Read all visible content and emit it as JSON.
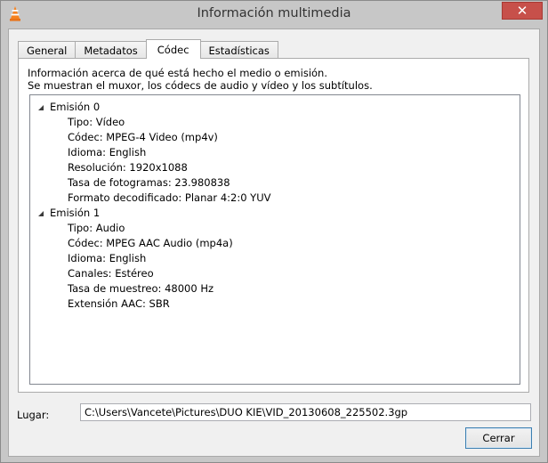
{
  "window": {
    "title": "Información multimedia",
    "close_glyph": "✕"
  },
  "tabs": [
    {
      "label": "General",
      "active": false
    },
    {
      "label": "Metadatos",
      "active": false
    },
    {
      "label": "Códec",
      "active": true
    },
    {
      "label": "Estadísticas",
      "active": false
    }
  ],
  "codec": {
    "description_line1": "Información acerca de qué está hecho el medio o emisión.",
    "description_line2": "Se muestran el muxor, los códecs de audio y vídeo y los subtítulos.",
    "streams": [
      {
        "label": "Emisión 0",
        "expanded": true,
        "items": [
          "Tipo: Vídeo",
          "Códec: MPEG-4 Video (mp4v)",
          "Idioma: English",
          "Resolución: 1920x1088",
          "Tasa de fotogramas: 23.980838",
          "Formato decodificado: Planar 4:2:0 YUV"
        ]
      },
      {
        "label": "Emisión 1",
        "expanded": true,
        "items": [
          "Tipo: Audio",
          "Códec: MPEG AAC Audio (mp4a)",
          "Idioma: English",
          "Canales: Estéreo",
          "Tasa de muestreo: 48000 Hz",
          "Extensión AAC: SBR"
        ]
      }
    ]
  },
  "footer": {
    "location_label": "Lugar:",
    "location_value": "C:\\Users\\Vancete\\Pictures\\DUO KIE\\VID_20130608_225502.3gp",
    "close_button_label": "Cerrar"
  },
  "icons": {
    "app": "vlc-cone-icon",
    "expander": "triangle-expanded-icon"
  },
  "colors": {
    "titlebar": "#c7c7c7",
    "close_button": "#c7504a",
    "client_bg": "#f0f0f0",
    "panel_bg": "#ffffff",
    "button_border": "#3c7fb1"
  }
}
